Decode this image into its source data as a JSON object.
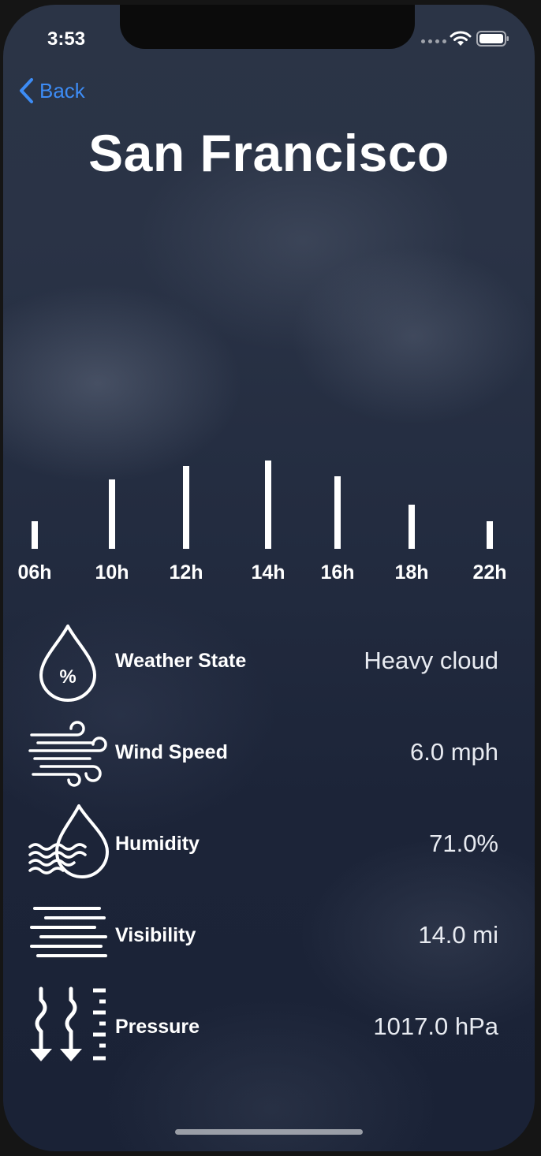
{
  "status_bar": {
    "time": "3:53"
  },
  "nav": {
    "back_label": "Back"
  },
  "city": "San Francisco",
  "chart_data": {
    "type": "bar",
    "categories": [
      "06h",
      "10h",
      "12h",
      "14h",
      "16h",
      "18h",
      "22h"
    ],
    "values": [
      3.5,
      8.8,
      10.5,
      11.2,
      9.2,
      5.6,
      3.5
    ],
    "ylim": [
      0,
      12
    ],
    "title": "",
    "xlabel": "",
    "ylabel": "",
    "grid": false
  },
  "stats": [
    {
      "icon": "humidity-drop-percent-icon",
      "label": "Weather State",
      "value": "Heavy cloud"
    },
    {
      "icon": "wind-icon",
      "label": "Wind Speed",
      "value": "6.0 mph"
    },
    {
      "icon": "water-drop-waves-icon",
      "label": "Humidity",
      "value": "71.0%"
    },
    {
      "icon": "fog-lines-icon",
      "label": "Visibility",
      "value": "14.0 mi"
    },
    {
      "icon": "pressure-arrows-icon",
      "label": "Pressure",
      "value": "1017.0 hPa"
    }
  ],
  "colors": {
    "accent": "#3d8cf5",
    "text": "#ffffff"
  }
}
